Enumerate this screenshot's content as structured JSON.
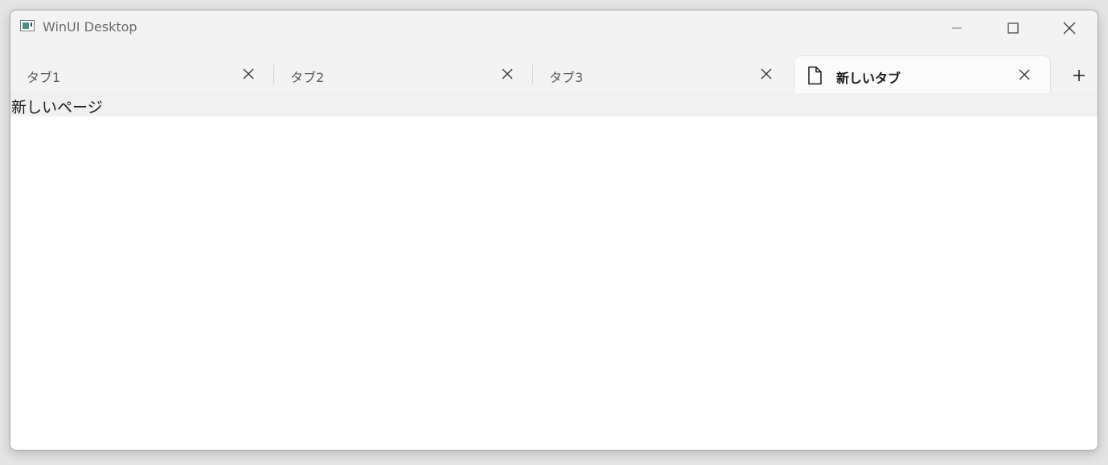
{
  "window": {
    "title": "WinUI Desktop"
  },
  "icons": {
    "app": "app-window-icon",
    "minimize": "minimize-icon",
    "maximize": "maximize-icon",
    "close": "close-icon",
    "tab_close": "close-icon",
    "document": "document-icon",
    "add": "plus-icon"
  },
  "tabs": [
    {
      "label": "タブ1",
      "selected": false
    },
    {
      "label": "タブ2",
      "selected": false
    },
    {
      "label": "タブ3",
      "selected": false
    },
    {
      "label": "新しいタブ",
      "selected": true
    }
  ],
  "content": {
    "text": "新しいページ"
  },
  "colors": {
    "window_bg": "#f3f3f3",
    "content_bg": "#ffffff",
    "selected_tab_bg": "#fbfbfb"
  }
}
